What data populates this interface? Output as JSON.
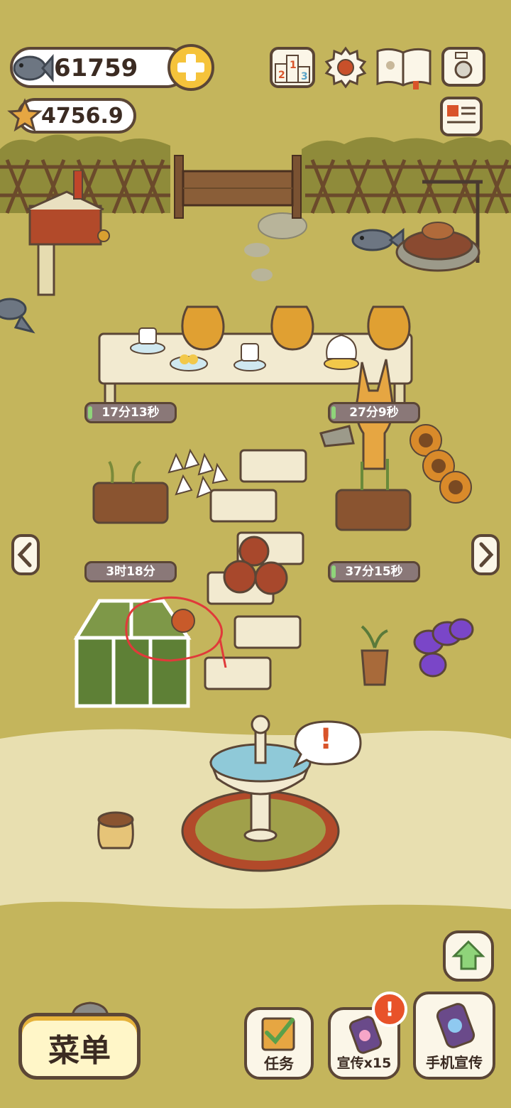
{
  "hud": {
    "fish_count": "61759",
    "star_count": "4756.9",
    "rank_digits": "213"
  },
  "plots": {
    "top_left_timer": "17分13秒",
    "top_right_timer": "27分9秒",
    "bottom_left_timer": "3时18分",
    "bottom_right_timer": "37分15秒"
  },
  "bubble": {
    "alert": "!"
  },
  "buttons": {
    "menu": "菜单",
    "tasks": "任务",
    "promote": "宣传x15",
    "phone_promote": "手机宣传"
  },
  "badges": {
    "promote_alert": "!"
  },
  "colors": {
    "grass": "#c4b55c",
    "path": "#e8dfb0",
    "outline": "#5b4636",
    "accent_yellow": "#f5c33b",
    "annotation_red": "#e03a3a"
  }
}
